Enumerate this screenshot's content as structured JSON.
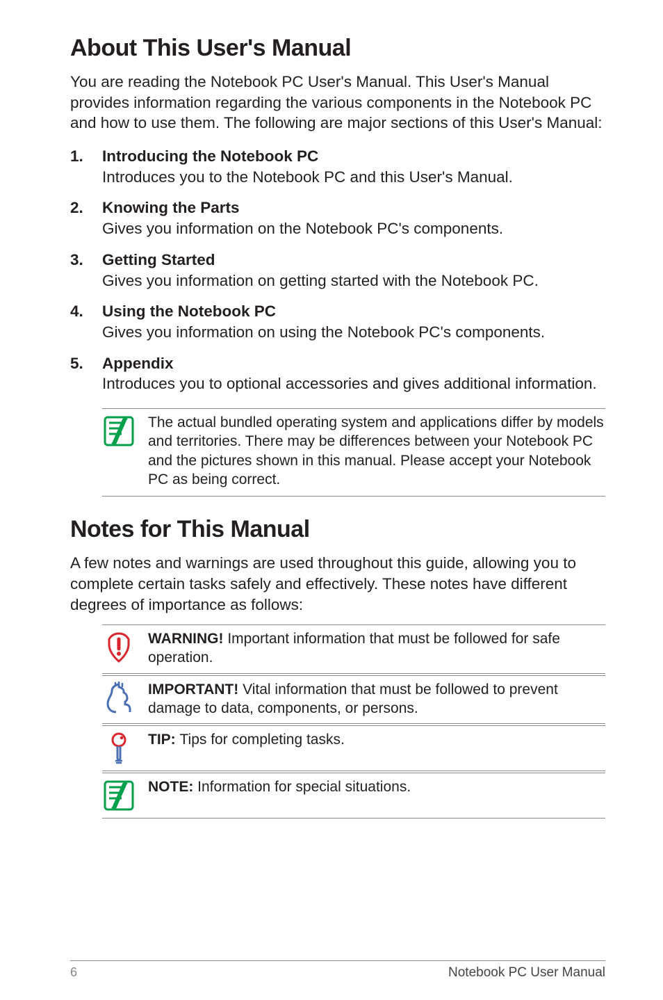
{
  "heading1": "About This User's Manual",
  "intro1": "You are reading the Notebook PC User's Manual. This User's Manual provides information regarding the various components in the Notebook PC and how to use them. The following are major sections of this User's Manual:",
  "sections": [
    {
      "title": "Introducing the Notebook PC",
      "desc": "Introduces you to the Notebook PC and this User's Manual."
    },
    {
      "title": "Knowing the Parts",
      "desc": "Gives you information on the Notebook PC's components."
    },
    {
      "title": "Getting Started",
      "desc": "Gives you information on getting started with the Notebook PC."
    },
    {
      "title": "Using the Notebook PC",
      "desc": "Gives you information on using the Notebook PC's components."
    },
    {
      "title": "Appendix",
      "desc": "Introduces you to optional accessories and gives additional information."
    }
  ],
  "noteA": "The actual bundled operating system and applications differ by models and territories. There may be differences between your Notebook PC and the pictures shown in this manual. Please accept your Notebook PC as being correct.",
  "heading2": "Notes for This Manual",
  "intro2": "A few notes and warnings are used throughout this guide, allowing you to complete certain tasks safely and effectively. These notes have different degrees of importance as follows:",
  "warn_label": "WARNING! ",
  "warn_text": "Important information that must be followed for safe operation.",
  "imp_label": "IMPORTANT! ",
  "imp_text": "Vital information that must be followed to prevent damage to data, components, or persons.",
  "tip_label": "TIP: ",
  "tip_text": "Tips for completing tasks.",
  "note_label": "NOTE:  ",
  "note_text": "Information for special situations.",
  "page_number": "6",
  "doc_title": "Notebook PC User Manual"
}
